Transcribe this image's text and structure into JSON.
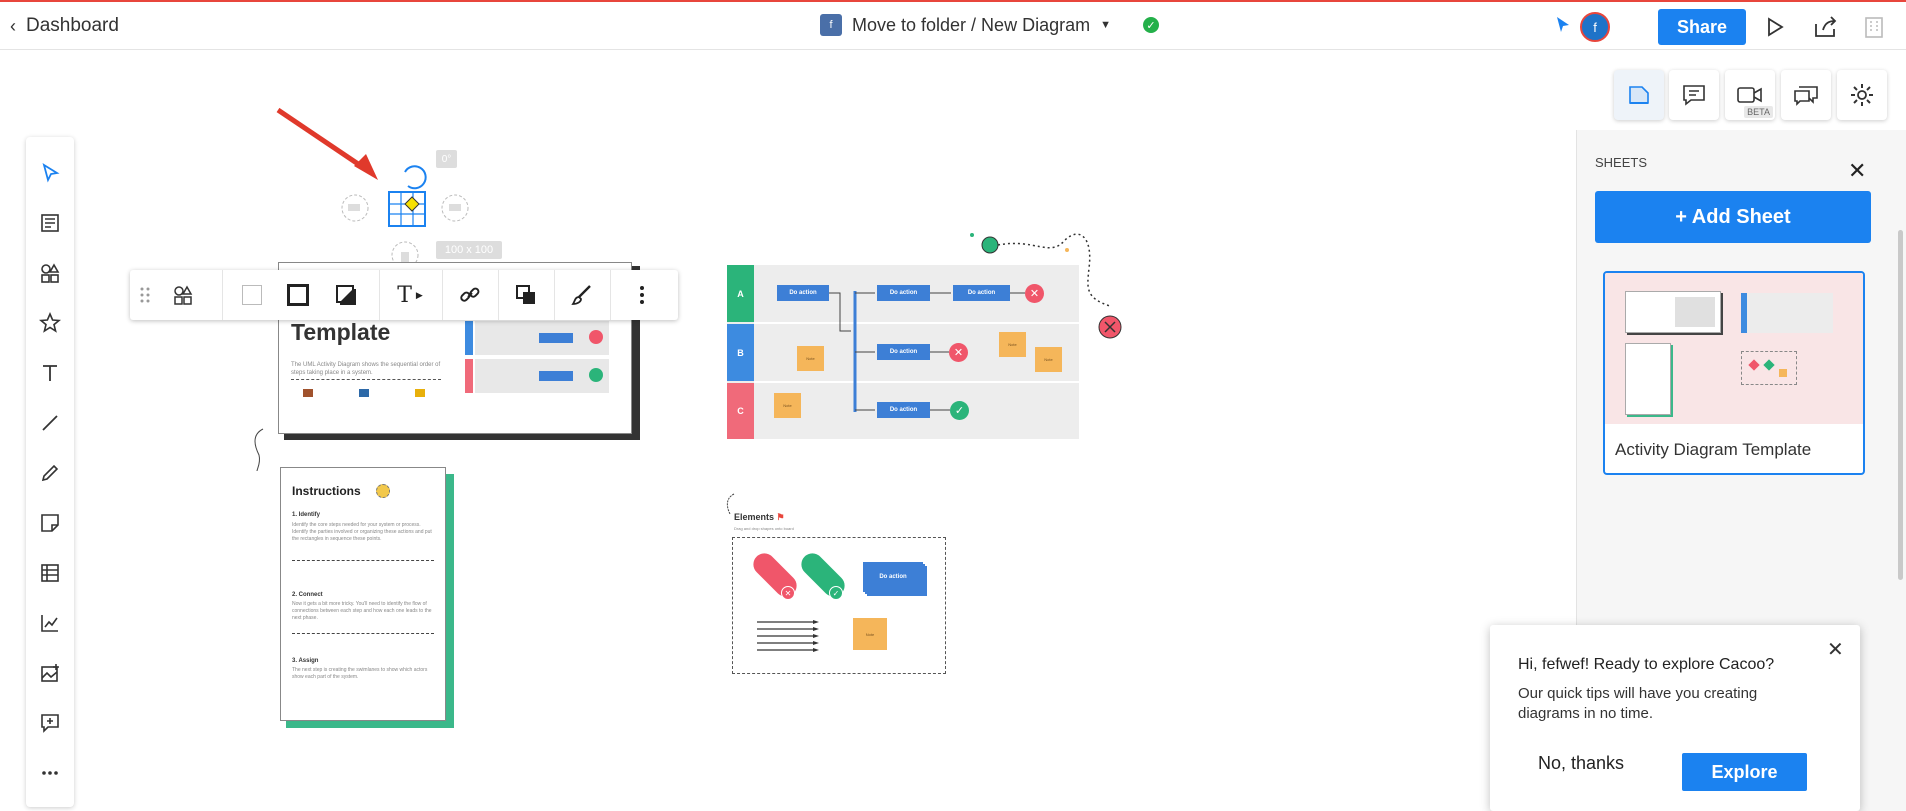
{
  "topbar": {
    "back_label": "Dashboard",
    "folder_badge": "f",
    "breadcrumb": "Move to folder / New Diagram",
    "avatar_letter": "f",
    "share_label": "Share"
  },
  "right_toolbar": {
    "beta_badge": "BETA"
  },
  "canvas": {
    "rotation_badge": "0°",
    "size_badge": "100 x 100",
    "template_card": {
      "title": "Template",
      "description": "The UML Activity Diagram shows the sequential order of steps taking place in a system."
    },
    "instructions_card": {
      "title": "Instructions",
      "steps": [
        {
          "title": "1. Identify",
          "text": "Identify the core steps needed for your system or process. Identify the parties involved or organizing these actions and put the rectangles in sequence these points."
        },
        {
          "title": "2. Connect",
          "text": "Now it gets a bit more tricky. You'll need to identify the flow of connections between each step and how each one leads to the next phase."
        },
        {
          "title": "3. Assign",
          "text": "The next step is creating the swimlanes to show which actors show each part of the system."
        }
      ]
    },
    "swimlanes": {
      "lanes": [
        "A",
        "B",
        "C"
      ],
      "action_label": "Do action",
      "note_label": "Note"
    },
    "elements_card": {
      "title": "Elements",
      "subtitle": "Drag and drop shapes onto board",
      "action_label": "Do action",
      "note_label": "Note"
    }
  },
  "sheets_panel": {
    "title": "SHEETS",
    "add_label": "Add Sheet",
    "sheets": [
      {
        "name": "Activity Diagram Template"
      }
    ]
  },
  "tips_dialog": {
    "title": "Hi, fefwef! Ready to explore Cacoo?",
    "body": "Our quick tips will have you creating diagrams in no time.",
    "decline_label": "No, thanks",
    "accept_label": "Explore"
  },
  "colors": {
    "accent": "#1b82f0",
    "lane_a": "#2bb47a",
    "lane_b": "#3d8be0",
    "lane_c": "#f06a7a",
    "action": "#3d7fd6",
    "note": "#f5b65a",
    "danger": "#f0566a",
    "success": "#2bb47a"
  }
}
